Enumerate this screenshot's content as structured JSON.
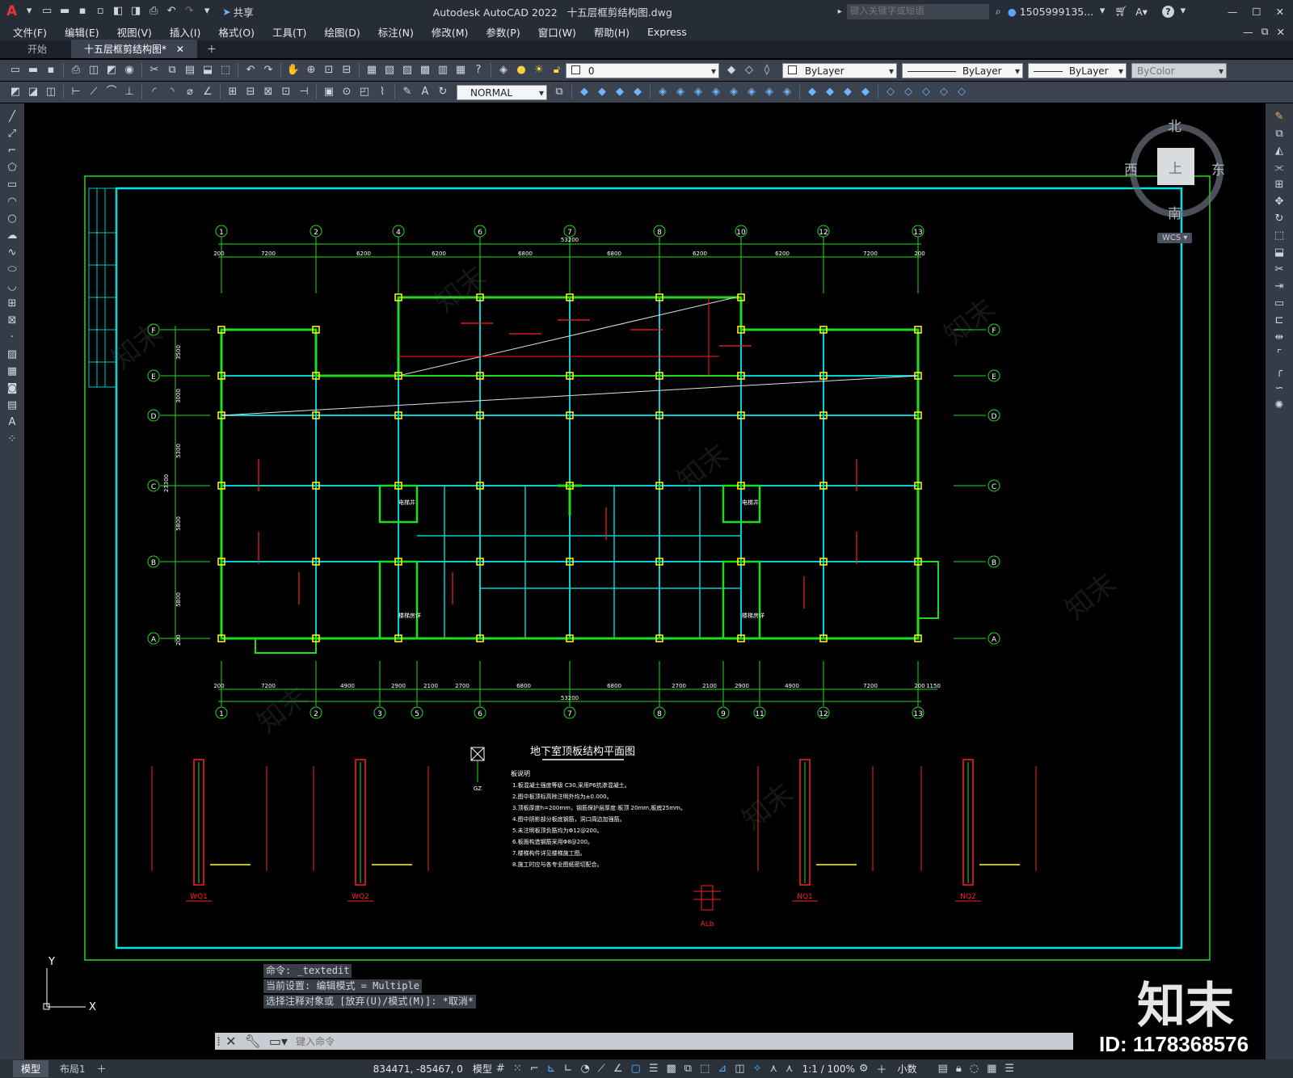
{
  "app": {
    "title": "Autodesk AutoCAD 2022",
    "file": "十五层框剪结构图.dwg",
    "search_placeholder": "键入关键字或短语",
    "user": "1505999135...",
    "share_label": "共享"
  },
  "menu": [
    "文件(F)",
    "编辑(E)",
    "视图(V)",
    "插入(I)",
    "格式(O)",
    "工具(T)",
    "绘图(D)",
    "标注(N)",
    "修改(M)",
    "参数(P)",
    "窗口(W)",
    "帮助(H)",
    "Express"
  ],
  "tabs": {
    "start": "开始",
    "doc": "十五层框剪结构图*"
  },
  "toolbar": {
    "layer": "0",
    "color": "ByLayer",
    "linetype": "ByLayer",
    "lineweight": "ByLayer",
    "plotstyle": "ByColor",
    "textstyle": "NORMAL"
  },
  "navcube": {
    "north": "北",
    "south": "南",
    "east": "东",
    "west": "西",
    "top": "上",
    "wcs": "WCS"
  },
  "drawing": {
    "title": "地下室顶板结构平面图",
    "axes_top": [
      "1",
      "2",
      "4",
      "6",
      "7",
      "8",
      "10",
      "12",
      "13"
    ],
    "axes_bottom": [
      "1",
      "2",
      "3",
      "5",
      "6",
      "7",
      "8",
      "9",
      "11",
      "12",
      "13"
    ],
    "axes_rows": [
      "F",
      "E",
      "D",
      "C",
      "B",
      "A"
    ],
    "dims_top": [
      "200",
      "7200",
      "6200",
      "6200",
      "6800",
      "6800",
      "6200",
      "6200",
      "7200",
      "200"
    ],
    "dim_total": "53200",
    "dims_bottom": [
      "200",
      "7200",
      "4900",
      "2900",
      "2100",
      "2700",
      "6800",
      "6800",
      "2700",
      "2100",
      "2900",
      "4900",
      "7200",
      "200",
      "1150"
    ],
    "dims_left": [
      "3500",
      "3000",
      "5300",
      "5800",
      "5800",
      "200"
    ],
    "dim_left_total": "23300",
    "rooms": [
      "电梯井",
      "电梯井",
      "楼梯房详",
      "楼梯房详"
    ],
    "sections": [
      "WQ1",
      "WQ2",
      "NQ1",
      "NQ2",
      "ALb"
    ],
    "notes_title": "板说明",
    "notes": [
      "1.板混凝土强度等级 C30,采用P6抗渗混凝土。",
      "2.图中板顶标高除注明外均为±0.000。",
      "3.顶板厚度h=200mm，钢筋保护层厚度:板顶 20mm,板底25mm。",
      "4.图中阴影部分板底钢筋，洞口周边加强筋。",
      "5.未注明板顶负筋均为Φ12@200。",
      "6.板面构造钢筋采用Φ8@200。",
      "7.楼梯构件详见楼梯施工图。",
      "8.施工时应与各专业图纸密切配合。"
    ]
  },
  "command": {
    "line1": "命令:  _textedit",
    "line2": "当前设置: 编辑模式 = Multiple",
    "line3": "选择注释对象或 [放弃(U)/模式(M)]: *取消*",
    "placeholder": "键入命令"
  },
  "status": {
    "model_tab": "模型",
    "layout_tab": "布局1",
    "coords": "834471, -85467, 0",
    "model_label": "模型",
    "scale": "1:1 / 100%",
    "units": "小数"
  },
  "watermark": {
    "brand": "知末",
    "id": "ID: 1178368576"
  }
}
